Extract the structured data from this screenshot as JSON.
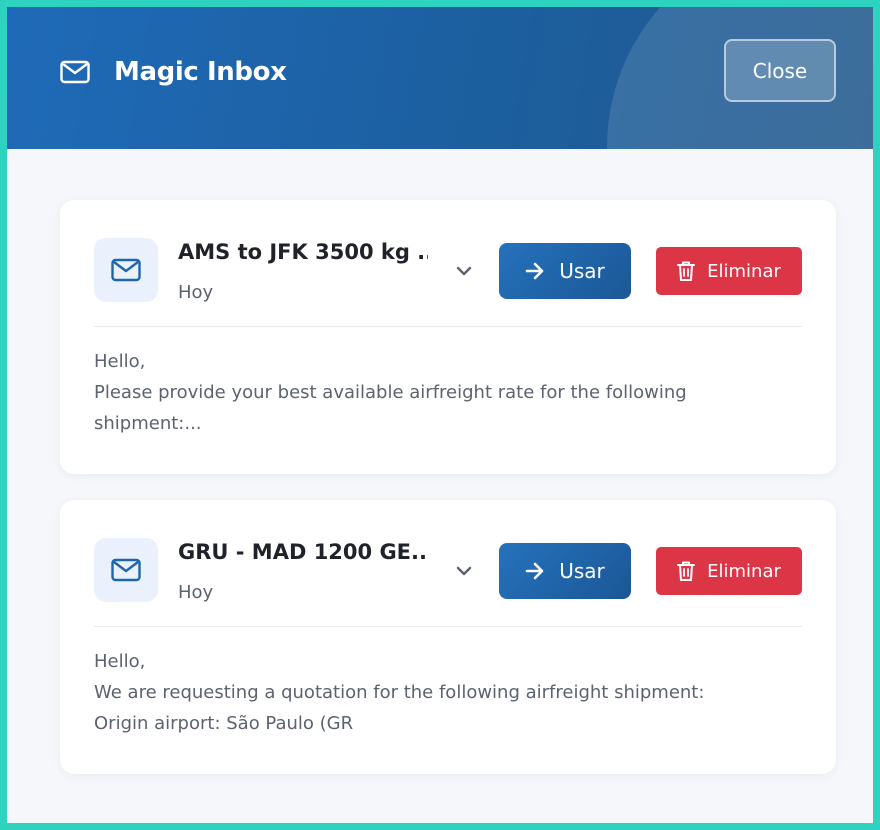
{
  "header": {
    "title": "Magic Inbox",
    "close_label": "Close",
    "icon": "mail-icon"
  },
  "items": [
    {
      "title": "AMS to JFK 3500 kg ...",
      "date": "Hoy",
      "use_label": "Usar",
      "delete_label": "Eliminar",
      "preview": [
        "Hello,",
        "Please provide your best available airfreight rate for the following",
        "shipment:..."
      ]
    },
    {
      "title": "GRU - MAD 1200 GE...",
      "date": "Hoy",
      "use_label": "Usar",
      "delete_label": "Eliminar",
      "preview": [
        "Hello,",
        "We are requesting a quotation for the following airfreight shipment:",
        "Origin airport: São Paulo (GR"
      ]
    }
  ],
  "colors": {
    "header_start": "#1f6ab8",
    "primary_button": "#1f65aa",
    "danger_button": "#dc3545",
    "frame": "#2ed3c0"
  }
}
